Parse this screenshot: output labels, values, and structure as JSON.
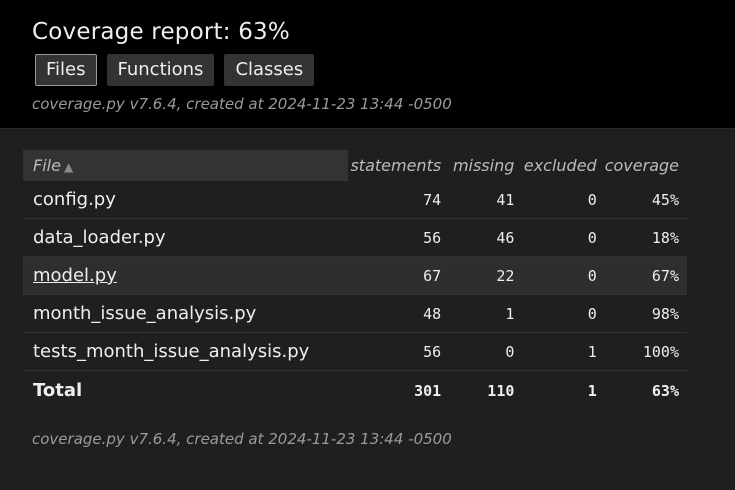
{
  "header": {
    "title": "Coverage report: 63%",
    "tabs": [
      {
        "label": "Files",
        "active": true
      },
      {
        "label": "Functions",
        "active": false
      },
      {
        "label": "Classes",
        "active": false
      }
    ],
    "created": "coverage.py v7.6.4, created at 2024-11-23 13:44 -0500"
  },
  "table": {
    "columns": [
      "File",
      "statements",
      "missing",
      "excluded",
      "coverage"
    ],
    "sort_icon": "triangle-up-icon",
    "rows": [
      {
        "file": "config.py",
        "statements": "74",
        "missing": "41",
        "excluded": "0",
        "coverage": "45%"
      },
      {
        "file": "data_loader.py",
        "statements": "56",
        "missing": "46",
        "excluded": "0",
        "coverage": "18%"
      },
      {
        "file": "model.py",
        "statements": "67",
        "missing": "22",
        "excluded": "0",
        "coverage": "67%"
      },
      {
        "file": "month_issue_analysis.py",
        "statements": "48",
        "missing": "1",
        "excluded": "0",
        "coverage": "98%"
      },
      {
        "file": "tests_month_issue_analysis.py",
        "statements": "56",
        "missing": "0",
        "excluded": "1",
        "coverage": "100%"
      }
    ],
    "total": {
      "file": "Total",
      "statements": "301",
      "missing": "110",
      "excluded": "1",
      "coverage": "63%"
    }
  },
  "footer": {
    "created": "coverage.py v7.6.4, created at 2024-11-23 13:44 -0500"
  }
}
